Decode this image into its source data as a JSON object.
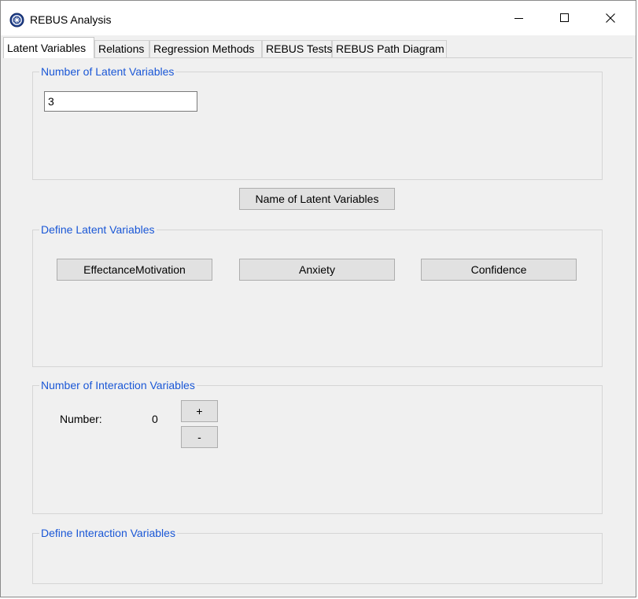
{
  "window": {
    "title": "REBUS Analysis",
    "icon": "app-logo-icon",
    "controls": {
      "minimize": "minimize-icon",
      "maximize": "maximize-icon",
      "close": "close-icon"
    }
  },
  "tabs": [
    {
      "label": "Latent Variables",
      "active": true
    },
    {
      "label": "Relations"
    },
    {
      "label": "Regression Methods"
    },
    {
      "label": "REBUS Tests"
    },
    {
      "label": "REBUS Path Diagram"
    }
  ],
  "latent_count_group": {
    "title": "Number of Latent Variables",
    "value": "3"
  },
  "name_button": {
    "label": "Name of Latent Variables"
  },
  "define_latent_group": {
    "title": "Define Latent Variables",
    "variables": [
      "EffectanceMotivation",
      "Anxiety",
      "Confidence"
    ]
  },
  "interaction_count_group": {
    "title": "Number of Interaction Variables",
    "number_label": "Number:",
    "number_value": "0",
    "plus_label": "+",
    "minus_label": "-"
  },
  "define_interaction_group": {
    "title": "Define Interaction Variables"
  },
  "colors": {
    "group_title": "#1a57d6",
    "background": "#f0f0f0",
    "button": "#e1e1e1"
  }
}
